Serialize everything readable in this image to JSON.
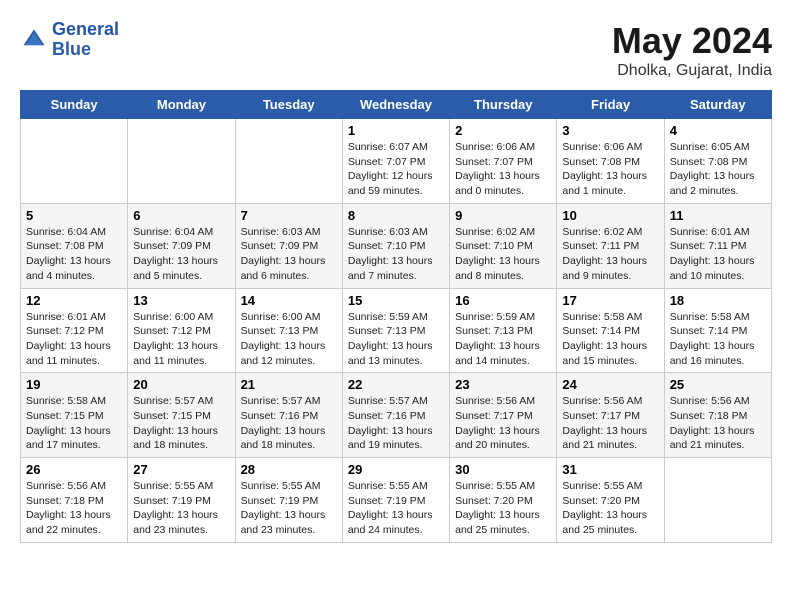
{
  "header": {
    "logo_line1": "General",
    "logo_line2": "Blue",
    "month_year": "May 2024",
    "location": "Dholka, Gujarat, India"
  },
  "weekdays": [
    "Sunday",
    "Monday",
    "Tuesday",
    "Wednesday",
    "Thursday",
    "Friday",
    "Saturday"
  ],
  "weeks": [
    [
      {
        "num": "",
        "sunrise": "",
        "sunset": "",
        "daylight": ""
      },
      {
        "num": "",
        "sunrise": "",
        "sunset": "",
        "daylight": ""
      },
      {
        "num": "",
        "sunrise": "",
        "sunset": "",
        "daylight": ""
      },
      {
        "num": "1",
        "sunrise": "Sunrise: 6:07 AM",
        "sunset": "Sunset: 7:07 PM",
        "daylight": "Daylight: 12 hours and 59 minutes."
      },
      {
        "num": "2",
        "sunrise": "Sunrise: 6:06 AM",
        "sunset": "Sunset: 7:07 PM",
        "daylight": "Daylight: 13 hours and 0 minutes."
      },
      {
        "num": "3",
        "sunrise": "Sunrise: 6:06 AM",
        "sunset": "Sunset: 7:08 PM",
        "daylight": "Daylight: 13 hours and 1 minute."
      },
      {
        "num": "4",
        "sunrise": "Sunrise: 6:05 AM",
        "sunset": "Sunset: 7:08 PM",
        "daylight": "Daylight: 13 hours and 2 minutes."
      }
    ],
    [
      {
        "num": "5",
        "sunrise": "Sunrise: 6:04 AM",
        "sunset": "Sunset: 7:08 PM",
        "daylight": "Daylight: 13 hours and 4 minutes."
      },
      {
        "num": "6",
        "sunrise": "Sunrise: 6:04 AM",
        "sunset": "Sunset: 7:09 PM",
        "daylight": "Daylight: 13 hours and 5 minutes."
      },
      {
        "num": "7",
        "sunrise": "Sunrise: 6:03 AM",
        "sunset": "Sunset: 7:09 PM",
        "daylight": "Daylight: 13 hours and 6 minutes."
      },
      {
        "num": "8",
        "sunrise": "Sunrise: 6:03 AM",
        "sunset": "Sunset: 7:10 PM",
        "daylight": "Daylight: 13 hours and 7 minutes."
      },
      {
        "num": "9",
        "sunrise": "Sunrise: 6:02 AM",
        "sunset": "Sunset: 7:10 PM",
        "daylight": "Daylight: 13 hours and 8 minutes."
      },
      {
        "num": "10",
        "sunrise": "Sunrise: 6:02 AM",
        "sunset": "Sunset: 7:11 PM",
        "daylight": "Daylight: 13 hours and 9 minutes."
      },
      {
        "num": "11",
        "sunrise": "Sunrise: 6:01 AM",
        "sunset": "Sunset: 7:11 PM",
        "daylight": "Daylight: 13 hours and 10 minutes."
      }
    ],
    [
      {
        "num": "12",
        "sunrise": "Sunrise: 6:01 AM",
        "sunset": "Sunset: 7:12 PM",
        "daylight": "Daylight: 13 hours and 11 minutes."
      },
      {
        "num": "13",
        "sunrise": "Sunrise: 6:00 AM",
        "sunset": "Sunset: 7:12 PM",
        "daylight": "Daylight: 13 hours and 11 minutes."
      },
      {
        "num": "14",
        "sunrise": "Sunrise: 6:00 AM",
        "sunset": "Sunset: 7:13 PM",
        "daylight": "Daylight: 13 hours and 12 minutes."
      },
      {
        "num": "15",
        "sunrise": "Sunrise: 5:59 AM",
        "sunset": "Sunset: 7:13 PM",
        "daylight": "Daylight: 13 hours and 13 minutes."
      },
      {
        "num": "16",
        "sunrise": "Sunrise: 5:59 AM",
        "sunset": "Sunset: 7:13 PM",
        "daylight": "Daylight: 13 hours and 14 minutes."
      },
      {
        "num": "17",
        "sunrise": "Sunrise: 5:58 AM",
        "sunset": "Sunset: 7:14 PM",
        "daylight": "Daylight: 13 hours and 15 minutes."
      },
      {
        "num": "18",
        "sunrise": "Sunrise: 5:58 AM",
        "sunset": "Sunset: 7:14 PM",
        "daylight": "Daylight: 13 hours and 16 minutes."
      }
    ],
    [
      {
        "num": "19",
        "sunrise": "Sunrise: 5:58 AM",
        "sunset": "Sunset: 7:15 PM",
        "daylight": "Daylight: 13 hours and 17 minutes."
      },
      {
        "num": "20",
        "sunrise": "Sunrise: 5:57 AM",
        "sunset": "Sunset: 7:15 PM",
        "daylight": "Daylight: 13 hours and 18 minutes."
      },
      {
        "num": "21",
        "sunrise": "Sunrise: 5:57 AM",
        "sunset": "Sunset: 7:16 PM",
        "daylight": "Daylight: 13 hours and 18 minutes."
      },
      {
        "num": "22",
        "sunrise": "Sunrise: 5:57 AM",
        "sunset": "Sunset: 7:16 PM",
        "daylight": "Daylight: 13 hours and 19 minutes."
      },
      {
        "num": "23",
        "sunrise": "Sunrise: 5:56 AM",
        "sunset": "Sunset: 7:17 PM",
        "daylight": "Daylight: 13 hours and 20 minutes."
      },
      {
        "num": "24",
        "sunrise": "Sunrise: 5:56 AM",
        "sunset": "Sunset: 7:17 PM",
        "daylight": "Daylight: 13 hours and 21 minutes."
      },
      {
        "num": "25",
        "sunrise": "Sunrise: 5:56 AM",
        "sunset": "Sunset: 7:18 PM",
        "daylight": "Daylight: 13 hours and 21 minutes."
      }
    ],
    [
      {
        "num": "26",
        "sunrise": "Sunrise: 5:56 AM",
        "sunset": "Sunset: 7:18 PM",
        "daylight": "Daylight: 13 hours and 22 minutes."
      },
      {
        "num": "27",
        "sunrise": "Sunrise: 5:55 AM",
        "sunset": "Sunset: 7:19 PM",
        "daylight": "Daylight: 13 hours and 23 minutes."
      },
      {
        "num": "28",
        "sunrise": "Sunrise: 5:55 AM",
        "sunset": "Sunset: 7:19 PM",
        "daylight": "Daylight: 13 hours and 23 minutes."
      },
      {
        "num": "29",
        "sunrise": "Sunrise: 5:55 AM",
        "sunset": "Sunset: 7:19 PM",
        "daylight": "Daylight: 13 hours and 24 minutes."
      },
      {
        "num": "30",
        "sunrise": "Sunrise: 5:55 AM",
        "sunset": "Sunset: 7:20 PM",
        "daylight": "Daylight: 13 hours and 25 minutes."
      },
      {
        "num": "31",
        "sunrise": "Sunrise: 5:55 AM",
        "sunset": "Sunset: 7:20 PM",
        "daylight": "Daylight: 13 hours and 25 minutes."
      },
      {
        "num": "",
        "sunrise": "",
        "sunset": "",
        "daylight": ""
      }
    ]
  ]
}
